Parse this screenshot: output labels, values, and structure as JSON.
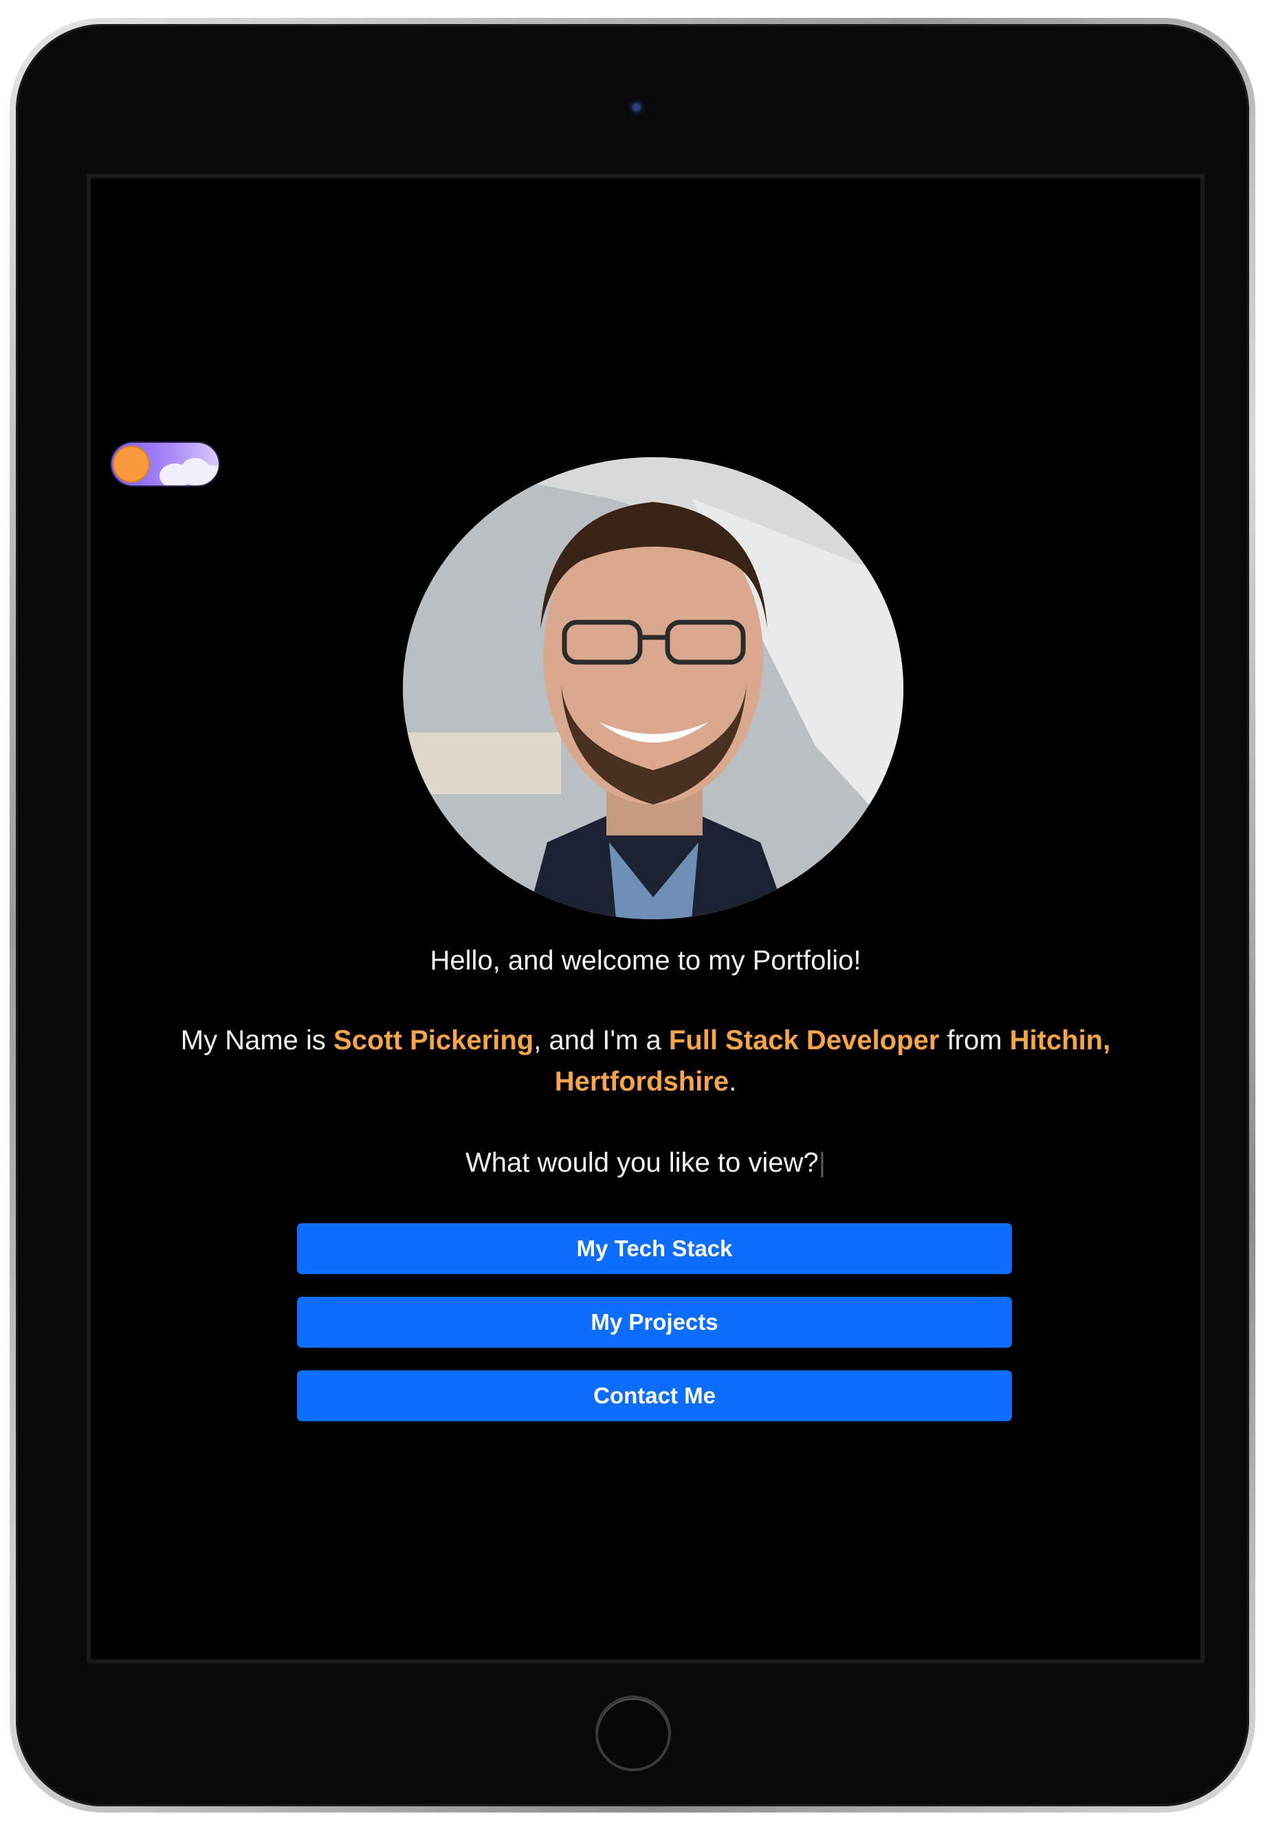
{
  "theme": {
    "background": "#000000",
    "text_color": "#f2f2f2",
    "highlight_color": "#f7a54a",
    "button_color": "#0d6efd",
    "toggle_knob_color": "#f89a3b",
    "toggle_track_color": "#a889f7"
  },
  "theme_toggle": {
    "state": "off",
    "icon": "sun-cloud-icon"
  },
  "profile": {
    "avatar_icon": "profile-photo"
  },
  "welcome": "Hello, and welcome to my Portfolio!",
  "intro": {
    "prefix": "My Name is ",
    "name": "Scott Pickering",
    "middle1": ", and I'm a ",
    "role": "Full Stack Developer",
    "middle2": " from ",
    "location": "Hitchin, Hertfordshire",
    "suffix": "."
  },
  "question": "What would you like to view?",
  "question_cursor": "|",
  "buttons": {
    "tech_stack": "My Tech Stack",
    "projects": "My Projects",
    "contact": "Contact Me"
  }
}
